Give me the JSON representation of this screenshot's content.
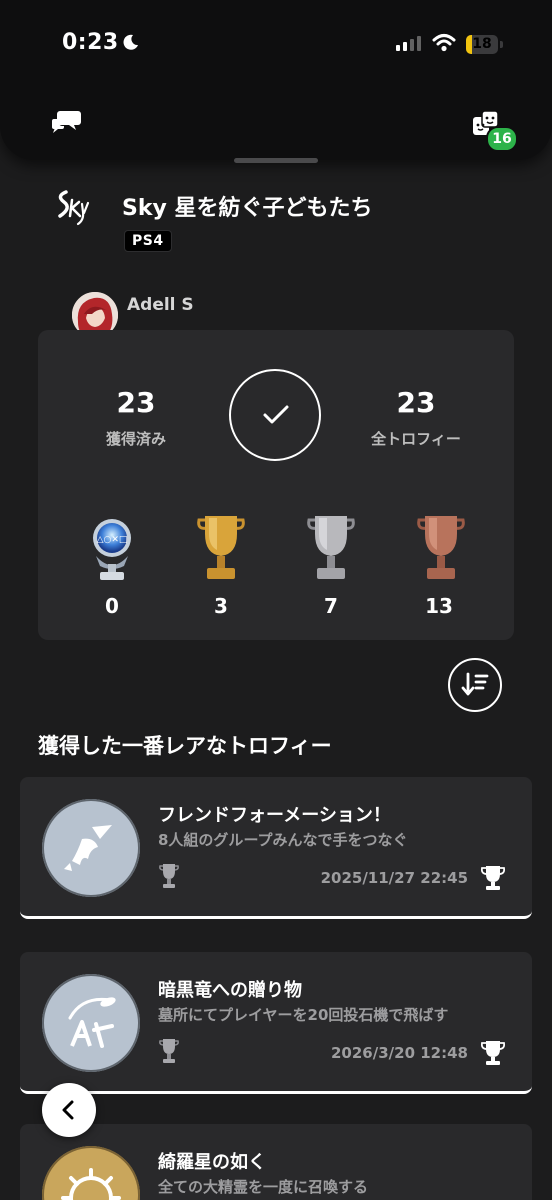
{
  "status": {
    "time": "0:23",
    "battery": "18"
  },
  "header": {
    "notification_badge": "16"
  },
  "game": {
    "title": "Sky 星を紡ぐ子どもたち",
    "platform": "PS4"
  },
  "user": {
    "name": "Adell S"
  },
  "summary": {
    "earned": "23",
    "earned_label": "獲得済み",
    "total": "23",
    "total_label": "全トロフィー",
    "platinum": "0",
    "gold": "3",
    "silver": "7",
    "bronze": "13"
  },
  "section": {
    "title": "獲得した一番レアなトロフィー"
  },
  "trophies": [
    {
      "name": "フレンドフォーメーション！",
      "desc": "8人組のグループみんなで手をつなぐ",
      "date": "2025/11/27  22:45",
      "grade": "silver"
    },
    {
      "name": "暗黒竜への贈り物",
      "desc": "墓所にてプレイヤーを20回投石機で飛ばす",
      "date": "2026/3/20  12:48",
      "grade": "silver"
    },
    {
      "name": "綺羅星の如く",
      "desc": "全ての大精霊を一度に召喚する",
      "grade": "gold"
    }
  ],
  "colors": {
    "accent_green": "#2db34a",
    "gold": "#d9a43a",
    "silver": "#b8b8bc",
    "bronze": "#b8735c"
  }
}
